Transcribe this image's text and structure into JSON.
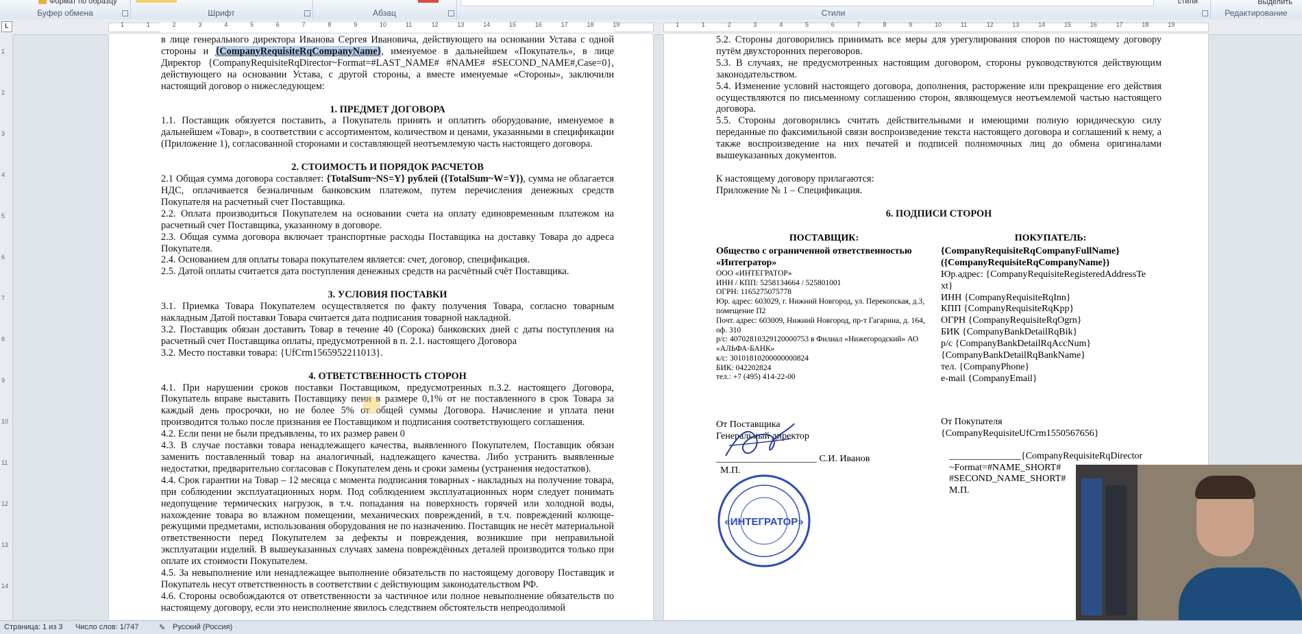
{
  "ribbon": {
    "format_painter": "Формат по образцу",
    "groups": [
      {
        "label": "Буфер обмена"
      },
      {
        "label": "Шрифт"
      },
      {
        "label": "Абзац"
      },
      {
        "label": "Стили"
      },
      {
        "label": "Редактирование"
      }
    ],
    "styles_more": "стили",
    "select_label": "Выделить"
  },
  "page1": {
    "intro_1": "в лице генерального директора Иванова Сергея Ивановича, действующего на основании Устава с одной стороны и ",
    "intro_field": "{CompanyRequisiteRqCompanyName}",
    "intro_2": ", именуемое в дальнейшем «Покупатель», в лице Директор {CompanyRequisiteRqDirector~Format=#LAST_NAME# #NAME# #SECOND_NAME#,Case=0}, действующего на основании Устава, с другой стороны, а вместе именуемые «Стороны», заключили настоящий договор о нижеследующем:",
    "s1_title": "1.    ПРЕДМЕТ ДОГОВОРА",
    "s1_p1": "1.1.      Поставщик обязуется поставить, а Покупатель принять и оплатить оборудование, именуемое в дальнейшем «Товар», в соответствии с ассортиментом, количеством и ценами, указанными в спецификации (Приложение 1), согласованной сторонами и составляющей неотъемлемую часть настоящего договора.",
    "s2_title": "2.    СТОИМОСТЬ  И ПОРЯДОК РАСЧЕТОВ",
    "s2_p1_a": "2.1  Общая сумма договора составляет: ",
    "s2_p1_b": "{TotalSum~NS=Y} рублей ({TotalSum~W=Y})",
    "s2_p1_c": ", сумма не облагается НДС, оплачивается безналичным банковским платежом, путем перечисления денежных средств Покупателя на расчетный счет Поставщика.",
    "s2_p2": "2.2. Оплата производиться Покупателем на основании счета на оплату единовременным платежом на расчетный счет Поставщика, указанному в договоре.",
    "s2_p3": "2.3. Общая сумма договора включает транспортные расходы Поставщика на доставку Товара до адреса Покупателя.",
    "s2_p4": "2.4. Основанием для оплаты товара покупателем является: счет, договор, спецификация.",
    "s2_p5": "2.5. Датой оплаты считается дата поступления денежных средств на расчётный счёт Поставщика.",
    "s3_title": "3. УСЛОВИЯ ПОСТАВКИ",
    "s3_p1": "3.1. Приемка Товара Покупателем осуществляется по факту получения Товара, согласно товарным накладным Датой поставки Товара считается дата подписания товарной накладной.",
    "s3_p2": "3.2. Поставщик обязан доставить Товар в течение 40 (Сорока) банковских дней с даты поступления на расчетный счет Поставщика оплаты, предусмотренной в п. 2.1. настоящего Договора",
    "s3_p3": "3.2. Место поставки товара: {UfCrm1565952211013}.",
    "s4_title": "4.  ОТВЕТСТВЕННОСТЬ СТОРОН",
    "s4_p1": "4.1. При нарушении сроков поставки Поставщиком, предусмотренных п.3.2. настоящего Договора, Покупатель вправе выставить Поставщику пени в размере 0,1% от не поставленного в срок Товара за каждый день просрочки, но не более 5% от общей суммы Договора. Начисление и уплата пени производится только после признания ее Поставщиком и подписания соответствующего соглашения.",
    "s4_p2": "4.2. Если пени не были предъявлены, то их размер равен 0",
    "s4_p3": "4.3. В случае поставки товара ненадлежащего качества, выявленного Покупателем, Поставщик обязан заменить поставленный товар на аналогичный, надлежащего качества. Либо устранить выявленные недостатки, предварительно согласовав с Покупателем день и сроки замены (устранения недостатков).",
    "s4_p4": "4.4. Срок гарантии на Товар – 12 месяца с момента подписания товарных - накладных на получение товара, при соблюдении эксплуатационных норм. Под соблюдением эксплуатационных норм следует понимать недопущение термических нагрузок, в т.ч. попадания на поверхность горячей или холодной воды, нахождение товара во влажном помещении, механических повреждений, в т.ч. повреждений колюще-режущими предметами, использования оборудования не по назначению. Поставщик не несёт материальной ответственности перед Покупателем за дефекты и повреждения, возникшие при неправильной эксплуатации изделий. В вышеуказанных случаях замена повреждённых деталей производится только при оплате их стоимости Покупателем.",
    "s4_p5": "4.5. За невыполнение или ненадлежащее выполнение обязательств по настоящему договору Поставщик и Покупатель несут ответственность в соответствии с действующим законодательством РФ.",
    "s4_p6": "4.6. Стороны освобождаются от ответственности за частичное или полное невыполнение обязательств по настоящему договору, если это неисполнение явилось следствием обстоятельств непреодолимой"
  },
  "page2": {
    "p52": "5.2. Стороны договорились принимать все меры для урегулирования споров по настоящему договору путём двухсторонних переговоров.",
    "p53": "5.3. В случаях, не предусмотренных настоящим договором, стороны руководствуются действующим законодательством.",
    "p54": "5.4. Изменение условий настоящего договора, дополнения, расторжение или прекращение его действия осуществляются по письменному соглашению сторон, являющемуся неотъемлемой частью настоящего договора.",
    "p55": "5.5. Стороны договорились считать действительными и имеющими полную юридическую силу переданные по факсимильной связи воспроизведение текста настоящего договора и соглашений к нему, а также воспроизведение на них печатей и подписей полномочных лиц до обмена оригиналами вышеуказанных документов.",
    "attach_1": "К настоящему договору прилагаются:",
    "attach_2": "Приложение № 1 – Спецификация.",
    "s6_title": "6. ПОДПИСИ СТОРОН",
    "supplier_title": "ПОСТАВЩИК:",
    "supplier_name": "Общество с ограниченной ответственностью «Интегратор»",
    "supplier_lines": [
      "ООО «ИНТЕГРАТОР»",
      "ИНН / КПП: 5258134664 / 525801001",
      "ОГРН: 1165275075778",
      "Юр. адрес:  603029, г. Нижний Новгород, ул. Перекопская, д.3, помещение П2",
      "Почт. адрес: 603009, Нижний Новгород, пр-т Гагарина,  д. 164, оф. 310",
      "р/с: 40702810329120000753 в Филиал «Нижегородский»  АО «АЛЬФА-БАНК»",
      "к/с: 30101810200000000824",
      "БИК: 042202824",
      "тел.: +7 (495) 414-22-00"
    ],
    "buyer_title": "ПОКУПАТЕЛЬ:",
    "buyer_name_1": "{CompanyRequisiteRqCompanyFullName}",
    "buyer_name_2": "({CompanyRequisiteRqCompanyName})",
    "buyer_lines": [
      "Юр.адрес: {CompanyRequisiteRegisteredAddressTe xt}",
      "ИНН {CompanyRequisiteRqInn}",
      "КПП {CompanyRequisiteRqKpp}",
      "ОГРН {CompanyRequisiteRqOgrn}",
      "БИК {CompanyBankDetailRqBik}",
      "р/с {CompanyBankDetailRqAccNum}",
      "{CompanyBankDetailRqBankName}",
      "тел. {CompanyPhone}",
      "e-mail {CompanyEmail}"
    ],
    "from_supplier": "От Поставщика",
    "gen_director": "Генеральный директор",
    "supplier_sign": "_____________________ С.И. Иванов",
    "mp_left": "М.П.",
    "from_buyer": "От Покупателя",
    "buyer_field": "{CompanyRequisiteUfCrm1550567656}",
    "buyer_sign_1": "_______________{CompanyRequisiteRqDirector",
    "buyer_sign_2": "~Format=#NAME_SHORT#",
    "buyer_sign_3": "#SECOND_NAME_SHORT#",
    "mp_right": "М.П.",
    "stamp_text": "«ИНТЕГРАТОР»"
  },
  "statusbar": {
    "page": "Страница: 1 из 3",
    "words": "Число слов: 1/747",
    "language": "Русский (Россия)"
  },
  "ruler_numbers": [
    "1",
    "1",
    "2",
    "3",
    "4",
    "5",
    "6",
    "7",
    "8",
    "9",
    "10",
    "11",
    "12",
    "13",
    "14",
    "15",
    "16",
    "17",
    "18",
    "19"
  ],
  "ruler2_numbers": [
    "1",
    "1",
    "2",
    "3",
    "4",
    "5",
    "6",
    "7",
    "8",
    "9",
    "10",
    "11",
    "12",
    "13",
    "14",
    "15",
    "16",
    "17",
    "18",
    "19"
  ]
}
